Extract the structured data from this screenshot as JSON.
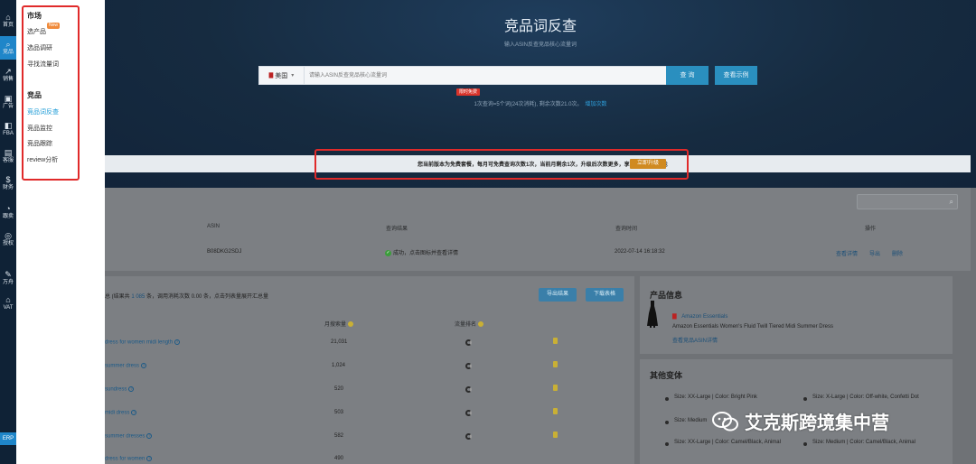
{
  "rail": {
    "items": [
      {
        "icon": "home-icon",
        "glyph": "⌂",
        "label": "首页"
      },
      {
        "icon": "search-icon",
        "glyph": "⌕",
        "label": "竞品"
      },
      {
        "icon": "trend-icon",
        "glyph": "↗",
        "label": "销售"
      },
      {
        "icon": "ad-icon",
        "glyph": "▣",
        "label": "广告"
      },
      {
        "icon": "fba-icon",
        "glyph": "◧",
        "label": "FBA"
      },
      {
        "icon": "service-icon",
        "glyph": "▤",
        "label": "客服"
      },
      {
        "icon": "finance-icon",
        "glyph": "$",
        "label": "财务"
      },
      {
        "icon": "analysis-icon",
        "glyph": "◔",
        "label": "跟卖"
      },
      {
        "icon": "auth-icon",
        "glyph": "◎",
        "label": "授权"
      },
      {
        "icon": "tool-icon",
        "glyph": "✎",
        "label": "万舟"
      },
      {
        "icon": "vat-icon",
        "glyph": "⌂",
        "label": "VAT"
      }
    ],
    "erp_label": "ERP"
  },
  "submenu": {
    "market_heading": "市场",
    "market_items": [
      "选产品",
      "选品调研",
      "寻找流量词"
    ],
    "new_badge": "New",
    "competitor_heading": "竞品",
    "competitor_items": [
      "竞品词反查",
      "竞品监控",
      "竞品跟踪",
      "review分析"
    ]
  },
  "hero": {
    "title": "竞品词反查",
    "subtitle": "输入ASIN反查竞品核心流量词",
    "market_flag": "▇",
    "market_label": "美国",
    "search_placeholder": "请输入ASIN反查竞品核心流量词",
    "query_button": "查 询",
    "example_button": "查看示例",
    "limited_badge": "限时免费",
    "quota_text": "1次查询=5个词(24次消耗), 剩余次数21.0次。",
    "quota_link": "增加次数"
  },
  "notice": {
    "text": "您当前版本为免费套餐，每月可免费查询次数1次，当前月剩余1次，升级后次数更多，享受更多高级功能",
    "upgrade_button": "立即升级"
  },
  "results": {
    "headers": {
      "asin": "ASIN",
      "status": "查询结果",
      "time": "查询时间",
      "ops": "操作"
    },
    "row": {
      "asin": "B08DKG2SDJ",
      "status": "成功，点击图标并查看详情",
      "time": "2022-07-14 16:18:32",
      "ops": [
        "查看详情",
        "导出",
        "删除"
      ]
    }
  },
  "keywords": {
    "summary_prefix": "总 (结果共",
    "summary_count": "1 085",
    "summary_suffix": "条，调用消耗次数 0.00 条，点击列表量展开汇总量",
    "btn_export": "导出结果",
    "btn_download": "下载表格",
    "header_search": "月搜索量",
    "header_competition": "流量排名",
    "rows": [
      {
        "kw": "dress for women midi length",
        "value": "21,031"
      },
      {
        "kw": "summer dress",
        "value": "1,024"
      },
      {
        "kw": "sundress",
        "value": "520"
      },
      {
        "kw": "midi dress",
        "value": "503"
      },
      {
        "kw": "summer dresses",
        "value": "582"
      },
      {
        "kw": "dress for women",
        "value": "490"
      }
    ]
  },
  "product": {
    "heading": "产品信息",
    "flag": "▇",
    "brand": "Amazon Essentials",
    "title": "Amazon Essentials Women's Fluid Twill Tiered Midi Summer Dress",
    "link": "查看竞品ASIN详情"
  },
  "variants": {
    "heading": "其他变体",
    "items": [
      "Size: XX-Large | Color: Bright Pink",
      "Size: X-Large | Color: Off-white, Confetti Dot",
      "Size: Medium",
      "Size: XX-Large | Color: Camel/Black, Animal",
      "Size: Medium | Color: Camel/Black, Animal"
    ]
  },
  "watermark": {
    "text": "艾克斯跨境集中营"
  },
  "colors": {
    "accent": "#2a8fbf",
    "highlight": "#e02a2a",
    "upgrade": "#d08a21"
  }
}
